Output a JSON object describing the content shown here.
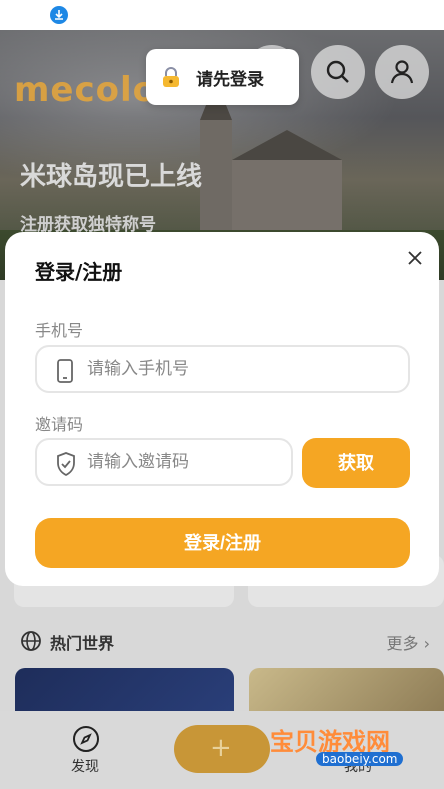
{
  "hero": {
    "logo_text": "mecolo",
    "title": "米球岛现已上线",
    "subtitle": "注册获取独特称号"
  },
  "toast": {
    "icon": "lock-icon",
    "text": "请先登录"
  },
  "header_buttons": {
    "search_icon": "search-icon",
    "profile_icon": "user-icon"
  },
  "section": {
    "title": "热门世界",
    "more": "更多"
  },
  "tabbar": {
    "discover_label": "发现",
    "mine_label": "我的"
  },
  "watermark": {
    "text": "宝贝游戏网",
    "url": "baobeiy.com"
  },
  "modal": {
    "title": "登录/注册",
    "phone_label": "手机号",
    "phone_placeholder": "请输入手机号",
    "invite_label": "邀请码",
    "invite_placeholder": "请输入邀请码",
    "get_code_label": "获取",
    "submit_label": "登录/注册"
  },
  "colors": {
    "accent": "#f5a623",
    "overlay": "#d8d8d8"
  }
}
